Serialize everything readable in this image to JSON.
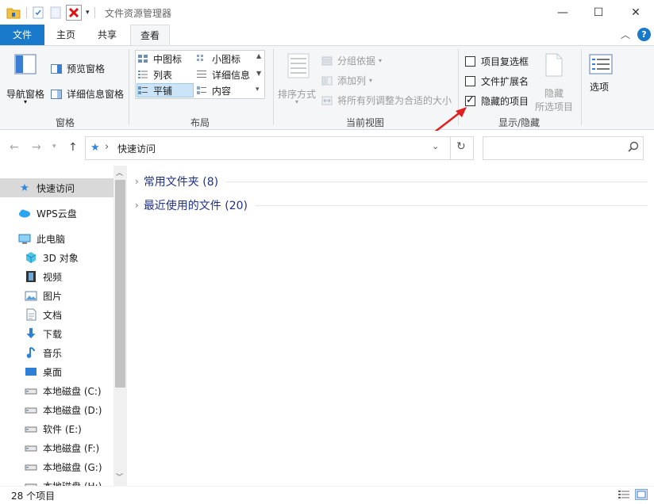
{
  "window": {
    "title": "文件资源管理器",
    "minimize": "—",
    "maximize": "☐",
    "close": "✕"
  },
  "tabs": [
    {
      "label": "文件"
    },
    {
      "label": "主页"
    },
    {
      "label": "共享"
    },
    {
      "label": "查看"
    }
  ],
  "ribbon": {
    "panes": {
      "label": "窗格",
      "nav_pane": "导航窗格",
      "preview_pane": "预览窗格",
      "details_pane": "详细信息窗格"
    },
    "layout": {
      "label": "布局",
      "items": [
        "中图标",
        "小图标",
        "列表",
        "详细信息",
        "平铺",
        "内容"
      ]
    },
    "current_view": {
      "label": "当前视图",
      "sort_by": "排序方式",
      "group_by": "分组依据",
      "add_columns": "添加列",
      "size_columns": "将所有列调整为合适的大小"
    },
    "show_hide": {
      "label": "显示/隐藏",
      "item_checkboxes": {
        "label": "项目复选框",
        "checked": false
      },
      "file_extensions": {
        "label": "文件扩展名",
        "checked": false
      },
      "hidden_items": {
        "label": "隐藏的项目",
        "checked": true
      },
      "hide_selected_line1": "隐藏",
      "hide_selected_line2": "所选项目"
    },
    "options": "选项"
  },
  "address": {
    "path": "快速访问",
    "separator": "›",
    "refresh": "↻"
  },
  "nav_pane": [
    {
      "label": "快速访问",
      "icon": "star-icon",
      "selected": true
    },
    {
      "label": "WPS云盘",
      "icon": "cloud-icon"
    },
    {
      "label": "此电脑",
      "icon": "computer-icon"
    },
    {
      "label": "3D 对象",
      "icon": "cube-icon"
    },
    {
      "label": "视频",
      "icon": "film-icon"
    },
    {
      "label": "图片",
      "icon": "picture-icon"
    },
    {
      "label": "文档",
      "icon": "document-icon"
    },
    {
      "label": "下载",
      "icon": "download-arrow-icon"
    },
    {
      "label": "音乐",
      "icon": "music-note-icon"
    },
    {
      "label": "桌面",
      "icon": "desktop-icon"
    },
    {
      "label": "本地磁盘 (C:)",
      "icon": "drive-icon"
    },
    {
      "label": "本地磁盘 (D:)",
      "icon": "drive-icon"
    },
    {
      "label": "软件 (E:)",
      "icon": "drive-icon"
    },
    {
      "label": "本地磁盘 (F:)",
      "icon": "drive-icon"
    },
    {
      "label": "本地磁盘 (G:)",
      "icon": "drive-icon"
    },
    {
      "label": "本地磁盘 (H:)",
      "icon": "drive-icon"
    }
  ],
  "content": {
    "groups": [
      {
        "label": "常用文件夹 (8)"
      },
      {
        "label": "最近使用的文件 (20)"
      }
    ]
  },
  "status": {
    "item_count": "28 个项目"
  },
  "colors": {
    "accent": "#1979ca",
    "annotation_arrow": "#e02020"
  }
}
